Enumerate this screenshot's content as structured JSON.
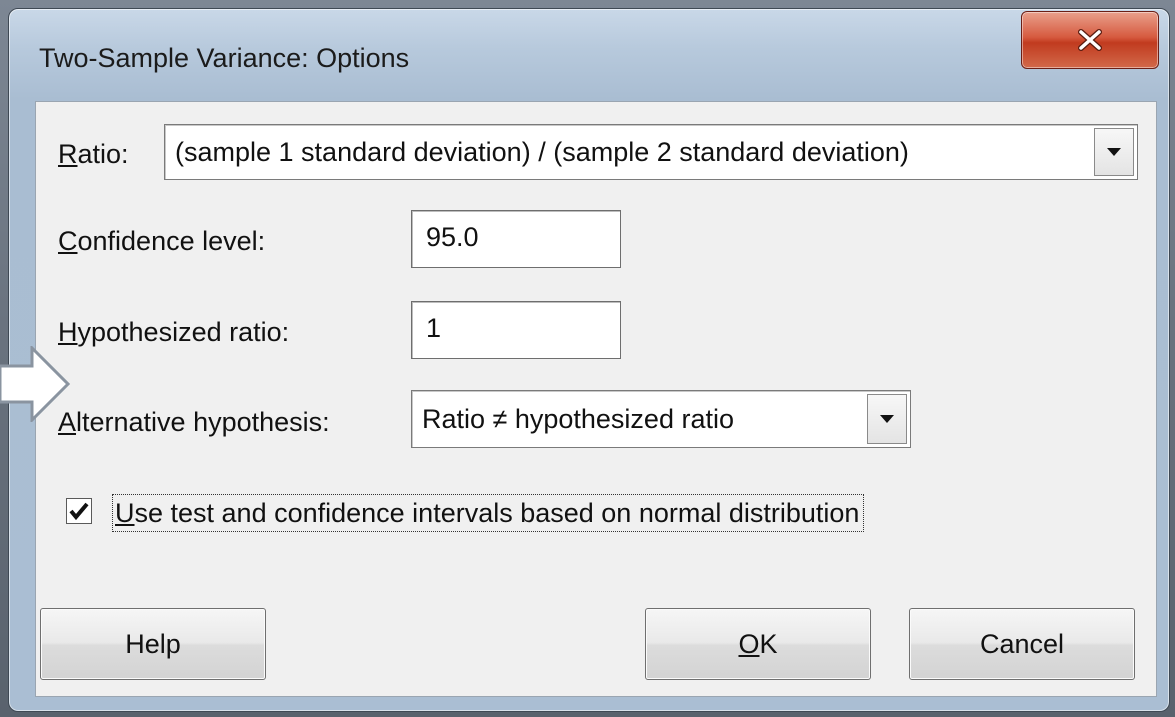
{
  "window": {
    "title": "Two-Sample Variance: Options"
  },
  "ratio": {
    "label_accel": "R",
    "label_rest": "atio:",
    "value": "(sample 1 standard deviation) / (sample 2 standard deviation)"
  },
  "confidence": {
    "label_accel": "C",
    "label_rest": "onfidence level:",
    "value": "95.0"
  },
  "hypothesized": {
    "label_accel": "H",
    "label_rest": "ypothesized ratio:",
    "value": "1"
  },
  "alternative": {
    "label_accel": "A",
    "label_rest": "lternative hypothesis:",
    "value": "Ratio ≠ hypothesized ratio"
  },
  "normal_option": {
    "checked": true,
    "label_accel": "U",
    "label_rest": "se test and confidence intervals based on normal distribution"
  },
  "buttons": {
    "help": "Help",
    "ok_accel": "O",
    "ok_rest": "K",
    "cancel": "Cancel"
  },
  "icons": [
    "close-icon",
    "dropdown-arrow-icon",
    "checkmark-icon",
    "pointer-arrow-icon"
  ],
  "colors": {
    "close_button": "#c94a2e",
    "dialog_face": "#f0f0f0",
    "title_bar": "#b7c9dc"
  }
}
